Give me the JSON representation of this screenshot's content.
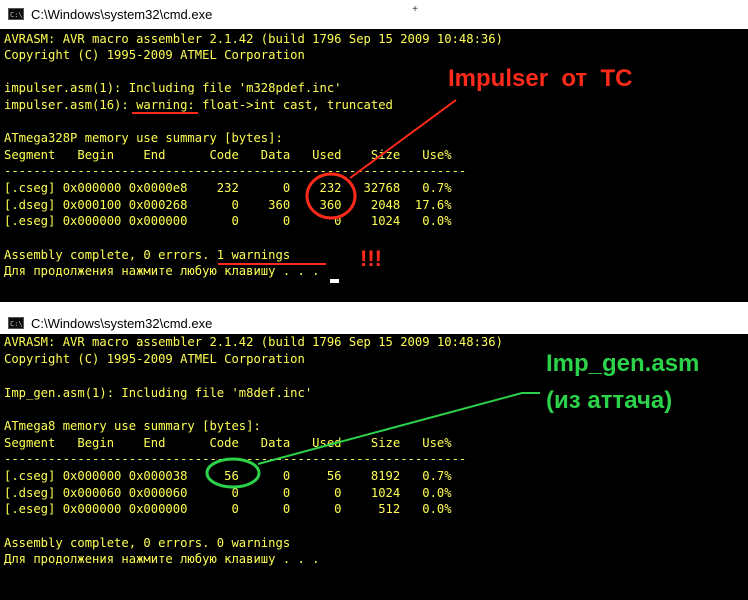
{
  "window1": {
    "title": "C:\\Windows\\system32\\cmd.exe",
    "lines": [
      "AVRASM: AVR macro assembler 2.1.42 (build 1796 Sep 15 2009 10:48:36)",
      "Copyright (C) 1995-2009 ATMEL Corporation",
      "",
      "impulser.asm(1): Including file 'm328pdef.inc'",
      "impulser.asm(16): warning: float->int cast, truncated",
      "",
      "ATmega328P memory use summary [bytes]:",
      "Segment   Begin    End      Code   Data   Used    Size   Use%",
      "---------------------------------------------------------------",
      "[.cseg] 0x000000 0x0000e8    232      0    232   32768   0.7%",
      "[.dseg] 0x000100 0x000268      0    360    360    2048  17.6%",
      "[.eseg] 0x000000 0x000000      0      0      0    1024   0.0%",
      "",
      "Assembly complete, 0 errors. 1 warnings",
      "Для продолжения нажмите любую клавишу . . ."
    ],
    "annotation": "Impulser  от  ТС",
    "exclamation": "!!!"
  },
  "window2": {
    "title": "C:\\Windows\\system32\\cmd.exe",
    "lines": [
      "AVRASM: AVR macro assembler 2.1.42 (build 1796 Sep 15 2009 10:48:36)",
      "Copyright (C) 1995-2009 ATMEL Corporation",
      "",
      "Imp_gen.asm(1): Including file 'm8def.inc'",
      "",
      "ATmega8 memory use summary [bytes]:",
      "Segment   Begin    End      Code   Data   Used    Size   Use%",
      "---------------------------------------------------------------",
      "[.cseg] 0x000000 0x000038     56      0     56    8192   0.7%",
      "[.dseg] 0x000060 0x000060      0      0      0    1024   0.0%",
      "[.eseg] 0x000000 0x000000      0      0      0     512   0.0%",
      "",
      "Assembly complete, 0 errors. 0 warnings",
      "Для продолжения нажмите любую клавишу . . ."
    ],
    "annotation_line1": "Imp_gen.asm",
    "annotation_line2": "(из аттача)"
  },
  "colors": {
    "console_bg": "#000000",
    "console_text": "#ffff54",
    "annotation_red": "#ff2a1a",
    "annotation_green": "#2bd24a"
  }
}
